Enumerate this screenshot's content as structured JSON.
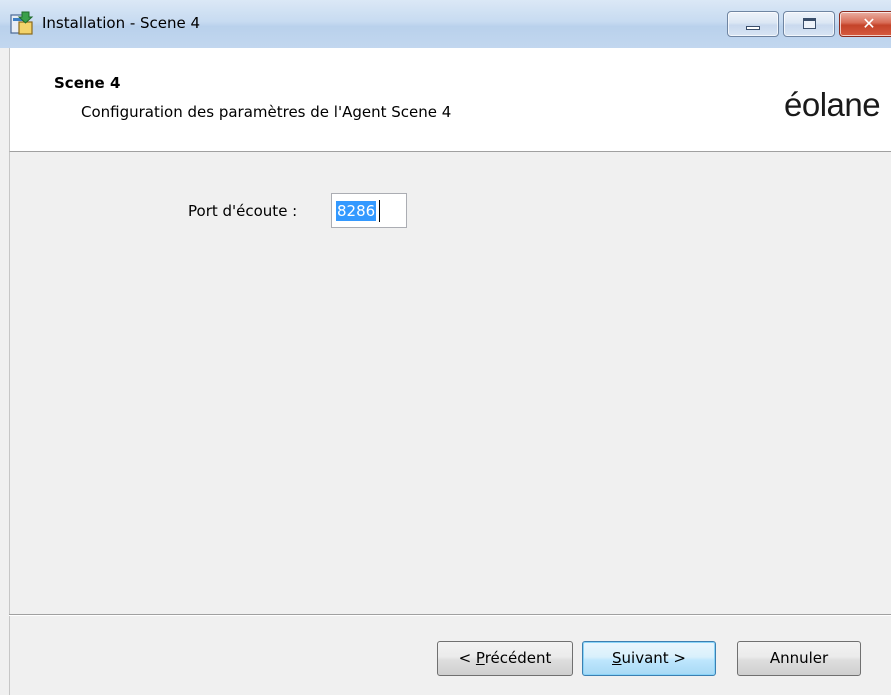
{
  "window": {
    "title": "Installation - Scene 4",
    "close_glyph": "✕"
  },
  "header": {
    "title": "Scene 4",
    "subtitle": "Configuration des paramètres de l'Agent Scene 4",
    "logo_text": "éolane"
  },
  "form": {
    "port_label": "Port d'écoute :",
    "port_value": "8286"
  },
  "buttons": {
    "prev_prefix": "< ",
    "prev_accel": "P",
    "prev_rest": "récédent",
    "next_accel": "S",
    "next_rest": "uivant >",
    "cancel_label": "Annuler"
  },
  "icons": {
    "app": "installer-icon",
    "minimize": "minimize-icon",
    "maximize": "maximize-icon",
    "close": "close-icon"
  },
  "colors": {
    "title_bar": "#c7dbf1",
    "close_button": "#c4432a",
    "selection": "#3399ff",
    "default_button_border": "#3c7fb1"
  }
}
